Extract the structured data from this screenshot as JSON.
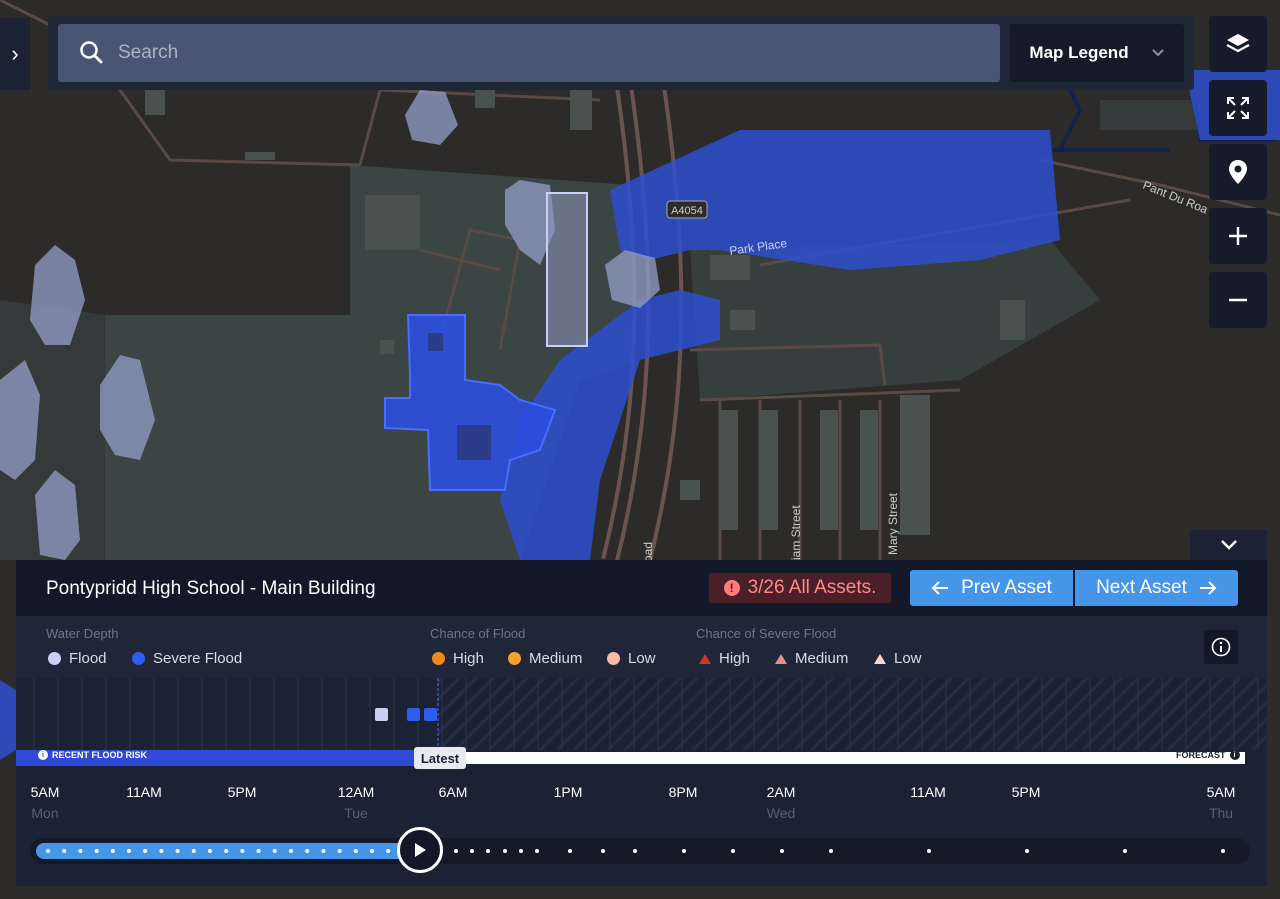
{
  "search": {
    "placeholder": "Search"
  },
  "map_legend_button": "Map Legend",
  "map_labels": {
    "road_a4054": "A4054",
    "park_place": "Park Place",
    "pant_du_road": "Pant Du Roa",
    "william_street": "iam Street",
    "mary_street": "Mary Street",
    "road_partial": "oad"
  },
  "asset": {
    "title": "Pontypridd High School - Main Building",
    "count": "3/26 All Assets.",
    "prev": "Prev Asset",
    "next": "Next Asset"
  },
  "legend": {
    "water_depth": {
      "title": "Water Depth",
      "items": [
        {
          "label": "Flood",
          "color": "#c8d1f5"
        },
        {
          "label": "Severe Flood",
          "color": "#2f5cf0"
        }
      ]
    },
    "chance_flood": {
      "title": "Chance of Flood",
      "items": [
        {
          "label": "High",
          "color": "#f08a1c"
        },
        {
          "label": "Medium",
          "color": "#f5a030"
        },
        {
          "label": "Low",
          "color": "#f7b9a8"
        }
      ]
    },
    "chance_severe": {
      "title": "Chance of Severe Flood",
      "items": [
        {
          "label": "High",
          "color": "#c8382c"
        },
        {
          "label": "Medium",
          "color": "#e98d87"
        },
        {
          "label": "Low",
          "color": "#f4d7d3"
        }
      ]
    }
  },
  "timeline": {
    "recent_label": "RECENT FLOOD RISK",
    "forecast_label": "FORECAST",
    "latest_label": "Latest",
    "ticks": [
      {
        "time": "5AM",
        "day": "Mon"
      },
      {
        "time": "11AM",
        "day": ""
      },
      {
        "time": "5PM",
        "day": ""
      },
      {
        "time": "12AM",
        "day": "Tue"
      },
      {
        "time": "6AM",
        "day": ""
      },
      {
        "time": "1PM",
        "day": ""
      },
      {
        "time": "8PM",
        "day": ""
      },
      {
        "time": "2AM",
        "day": "Wed"
      },
      {
        "time": "11AM",
        "day": ""
      },
      {
        "time": "5PM",
        "day": ""
      },
      {
        "time": "5AM",
        "day": "Thu"
      }
    ],
    "markers": [
      {
        "type": "Flood",
        "color": "#c8d1f5"
      },
      {
        "type": "Severe Flood",
        "color": "#2f5cf0"
      },
      {
        "type": "Severe Flood",
        "color": "#2f5cf0"
      }
    ]
  }
}
